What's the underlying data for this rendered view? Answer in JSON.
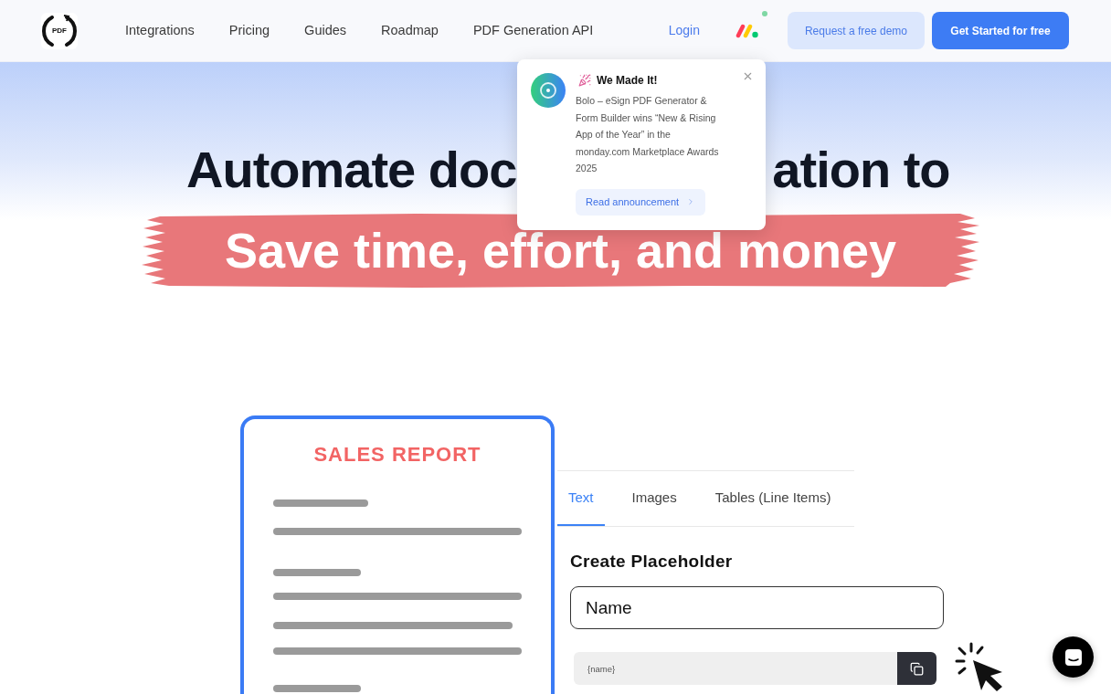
{
  "nav": {
    "logo_text": "PDF",
    "links": [
      "Integrations",
      "Pricing",
      "Guides",
      "Roadmap",
      "PDF Generation API"
    ],
    "login": "Login",
    "buttons": [
      {
        "label": "Request a free demo",
        "kind": "secondary"
      },
      {
        "label": "Get Started for free",
        "kind": "primary"
      }
    ]
  },
  "announcement": {
    "title": "We Made It!",
    "body": "Bolo – eSign PDF Generator & Form Builder wins “New & Rising App of the Year” in the monday.com Marketplace Awards 2025",
    "link": "Read announcement"
  },
  "hero": {
    "headline_visible_parts": [
      "Automate doc",
      "ation to"
    ],
    "highlight": "Save time, effort, and money"
  },
  "demo": {
    "document_title": "SALES REPORT",
    "tabs": [
      {
        "label": "Text",
        "selected": true
      },
      {
        "label": "Images",
        "selected": false
      },
      {
        "label": "Tables (Line Items)",
        "selected": false
      }
    ],
    "heading": "Create Placeholder",
    "field_value": "Name",
    "tag": "{name}"
  }
}
